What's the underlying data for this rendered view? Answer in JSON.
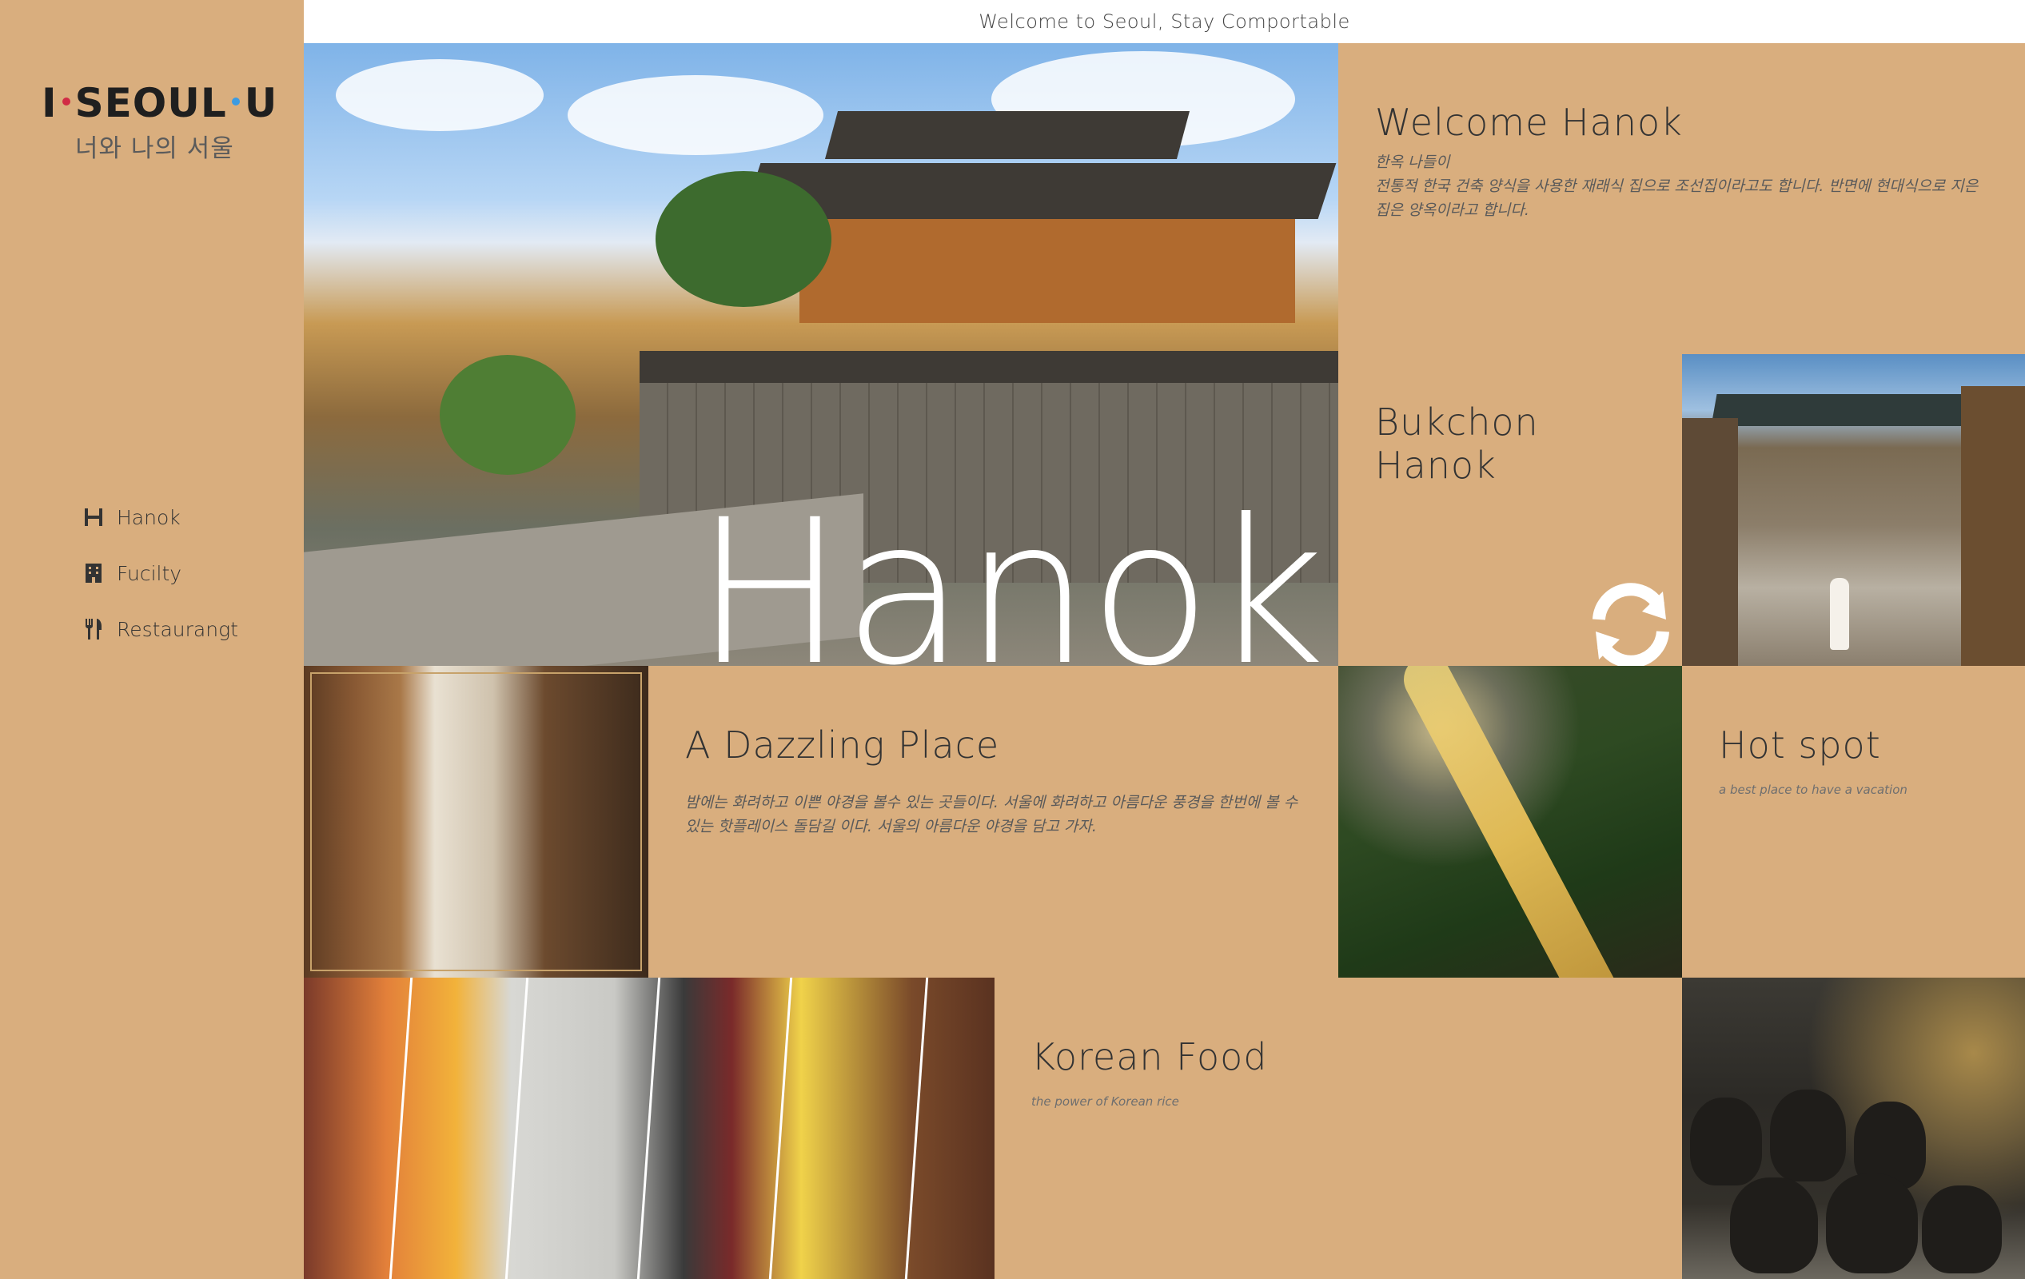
{
  "header": {
    "tagline": "Welcome to Seoul, Stay Comportable"
  },
  "logo": {
    "main_parts": [
      "I",
      "SEOUL",
      "U"
    ],
    "sub": "너와 나의 서울",
    "colors": {
      "red": "#D12B45",
      "blue": "#3C9BE2"
    }
  },
  "sidebar": {
    "items": [
      {
        "label": "Hanok",
        "icon": "h-icon"
      },
      {
        "label": "Fucilty",
        "icon": "building-icon"
      },
      {
        "label": "Restaurangt",
        "icon": "utensils-icon"
      }
    ]
  },
  "hero": {
    "word": "Hanok"
  },
  "welcome": {
    "title": "Welcome Hanok",
    "subtitle": "한옥 나들이",
    "body": "전통적 한국 건축 양식을 사용한 재래식 집으로 조선집이라고도 합니다. 반면에 현대식으로 지은 집은 양옥이라고 합니다."
  },
  "bukchon": {
    "title": "Bukchon Hanok"
  },
  "dazzling": {
    "title": "A Dazzling Place",
    "body": "밤에는 화려하고 이쁜 야경을 볼수 있는 곳들이다. 서울에 화려하고 아름다운 풍경을 한번에 볼 수 있는 핫플레이스 돌담길 이다. 서울의 아름다운 야경을 담고 가자."
  },
  "hotspot": {
    "title": "Hot spot",
    "caption": "a best place to have a vacation"
  },
  "food": {
    "title": "Korean Food",
    "caption": "the power of Korean rice"
  },
  "theme": {
    "background": "#D9AE7E",
    "topbar": "#ffffff"
  }
}
